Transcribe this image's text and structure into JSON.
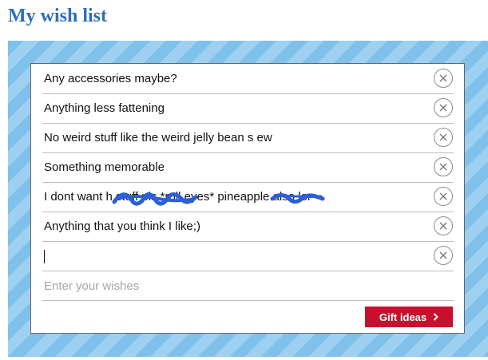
{
  "page": {
    "title": "My wish list"
  },
  "wishes": {
    "items": [
      {
        "text": "Any accessories maybe?"
      },
      {
        "text": "Anything less fattening"
      },
      {
        "text": "No weird stuff like the weird jelly bean s ew"
      },
      {
        "text": "Something memorable"
      },
      {
        "text": "I dont want h     stuff pls *roll eyes* pineapple also lor"
      },
      {
        "text": "Anything that you think I like;)"
      }
    ],
    "active_input_value": "",
    "new_wish_placeholder": "Enter your wishes"
  },
  "actions": {
    "gift_ideas_label": "Gift ideas"
  },
  "icons": {
    "remove": "close-circle-icon",
    "gift_arrow": "chevron-right-icon"
  },
  "colors": {
    "title": "#2e6eb5",
    "stripe_light": "#9ed1f1",
    "stripe_dark": "#7fc1ea",
    "gift_button": "#c8102e",
    "scribble": "#2b5fd9"
  }
}
